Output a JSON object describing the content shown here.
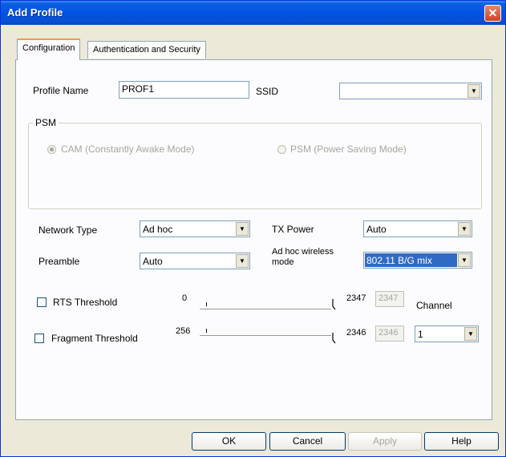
{
  "window": {
    "title": "Add Profile",
    "close_symbol": "✕"
  },
  "tabs": [
    {
      "label": "Configuration",
      "active": true
    },
    {
      "label": "Authentication and Security",
      "active": false
    }
  ],
  "profile": {
    "name_label": "Profile Name",
    "name_value": "PROF1"
  },
  "ssid": {
    "label": "SSID",
    "value": ""
  },
  "psm": {
    "title": "PSM",
    "options": [
      {
        "label": "CAM (Constantly Awake Mode)",
        "checked": true
      },
      {
        "label": "PSM (Power Saving Mode)",
        "checked": false
      }
    ]
  },
  "network_type": {
    "label": "Network Type",
    "value": "Ad hoc"
  },
  "tx_power": {
    "label": "TX Power",
    "value": "Auto"
  },
  "preamble": {
    "label": "Preamble",
    "value": "Auto"
  },
  "adhoc_mode": {
    "label_line1": "Ad hoc wireless",
    "label_line2": "mode",
    "value": "802.11 B/G mix"
  },
  "rts": {
    "label": "RTS Threshold",
    "min": "0",
    "max": "2347",
    "value": "2347",
    "checked": false
  },
  "fragment": {
    "label": "Fragment Threshold",
    "min": "256",
    "max": "2346",
    "value": "2346",
    "checked": false
  },
  "channel": {
    "label": "Channel",
    "value": "1"
  },
  "buttons": {
    "ok": "OK",
    "cancel": "Cancel",
    "apply": "Apply",
    "help": "Help"
  },
  "icons": {
    "dropdown_arrow": "▼"
  },
  "colors": {
    "titlebar": "#0054e3",
    "selection": "#316ac5",
    "dialog_bg": "#ece9d8"
  }
}
